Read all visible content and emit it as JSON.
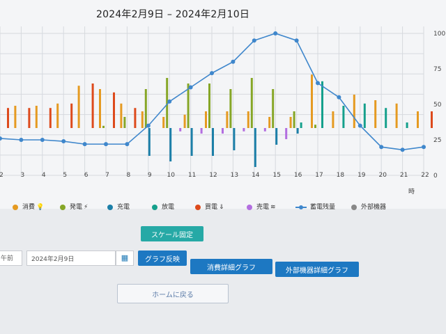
{
  "header": {
    "title": "2024年2月9日 – 2024年2月10日"
  },
  "chart_data": {
    "type": "bar",
    "x": [
      2,
      3,
      4,
      5,
      6,
      7,
      8,
      9,
      10,
      11,
      12,
      13,
      14,
      15,
      16,
      17,
      18,
      19,
      20,
      21,
      22
    ],
    "x_unit_label": "時",
    "y_right_ticks": [
      0,
      25,
      50,
      75,
      100
    ],
    "y_right_range": [
      0,
      100
    ],
    "grid": true,
    "legend_position": "bottom",
    "series": [
      {
        "name": "消費",
        "kind": "bar",
        "color": "#e59a21",
        "values": [
          20,
          20,
          20,
          22,
          38,
          35,
          22,
          15,
          10,
          12,
          15,
          15,
          15,
          10,
          10,
          48,
          15,
          30,
          25,
          22,
          15
        ]
      },
      {
        "name": "発電",
        "kind": "bar",
        "color": "#86a627",
        "values": [
          0,
          0,
          0,
          0,
          0,
          2,
          10,
          35,
          45,
          40,
          40,
          35,
          45,
          35,
          15,
          3,
          0,
          0,
          0,
          0,
          0
        ]
      },
      {
        "name": "充電",
        "kind": "bar",
        "color": "#1c7fa8",
        "values": [
          0,
          0,
          0,
          0,
          0,
          0,
          0,
          -25,
          -30,
          -25,
          -25,
          -20,
          -35,
          -15,
          -5,
          0,
          0,
          0,
          0,
          0,
          0
        ]
      },
      {
        "name": "放電",
        "kind": "bar",
        "color": "#15a08c",
        "values": [
          0,
          0,
          0,
          0,
          0,
          0,
          0,
          0,
          0,
          0,
          0,
          0,
          0,
          0,
          5,
          42,
          20,
          22,
          18,
          5,
          0
        ]
      },
      {
        "name": "買電",
        "kind": "bar",
        "color": "#dd4a1c",
        "values": [
          18,
          18,
          18,
          22,
          40,
          32,
          18,
          0,
          0,
          0,
          0,
          0,
          0,
          0,
          0,
          0,
          0,
          0,
          0,
          0,
          15
        ]
      },
      {
        "name": "売電",
        "kind": "bar",
        "color": "#b36ee0",
        "values": [
          0,
          0,
          0,
          0,
          0,
          0,
          0,
          0,
          -3,
          -5,
          -5,
          -3,
          -3,
          -10,
          0,
          0,
          0,
          0,
          0,
          0,
          0
        ]
      },
      {
        "name": "蓄電残量",
        "kind": "line",
        "color": "#3f87cc",
        "values": [
          26,
          25,
          25,
          24,
          22,
          22,
          22,
          35,
          52,
          62,
          72,
          80,
          95,
          100,
          95,
          65,
          55,
          35,
          20,
          18,
          20
        ]
      },
      {
        "name": "外部機器",
        "kind": "bar",
        "color": "#888888",
        "values": [
          0,
          0,
          0,
          0,
          0,
          0,
          0,
          0,
          0,
          0,
          0,
          0,
          0,
          0,
          0,
          0,
          0,
          0,
          0,
          0,
          0
        ]
      }
    ]
  },
  "legend": {
    "items": [
      {
        "label": "消費",
        "color": "#e59a21",
        "glyph": "💡",
        "icon": "bulb-icon"
      },
      {
        "label": "発電",
        "color": "#86a627",
        "glyph": "⚡",
        "icon": "lightning-icon"
      },
      {
        "label": "充電",
        "color": "#1c7fa8",
        "glyph": "",
        "icon": ""
      },
      {
        "label": "放電",
        "color": "#15a08c",
        "glyph": "",
        "icon": ""
      },
      {
        "label": "買電",
        "color": "#dd4a1c",
        "glyph": "⇓",
        "icon": "plug-icon"
      },
      {
        "label": "売電",
        "color": "#b36ee0",
        "glyph": "≋",
        "icon": "money-icon"
      },
      {
        "label": "蓄電残量",
        "color": "#3f87cc",
        "glyph": "",
        "icon": ""
      },
      {
        "label": "外部機器",
        "color": "#888888",
        "glyph": "",
        "icon": ""
      }
    ]
  },
  "controls": {
    "scale_fixed": "スケール固定",
    "prev_label": "午前",
    "date_value": "2024年2月9日",
    "calendar_icon": "calendar-icon",
    "apply_graph": "グラフ反映",
    "consumption_detail": "消費詳細グラフ",
    "external_detail": "外部機器詳細グラフ",
    "home": "ホームに戻る"
  }
}
